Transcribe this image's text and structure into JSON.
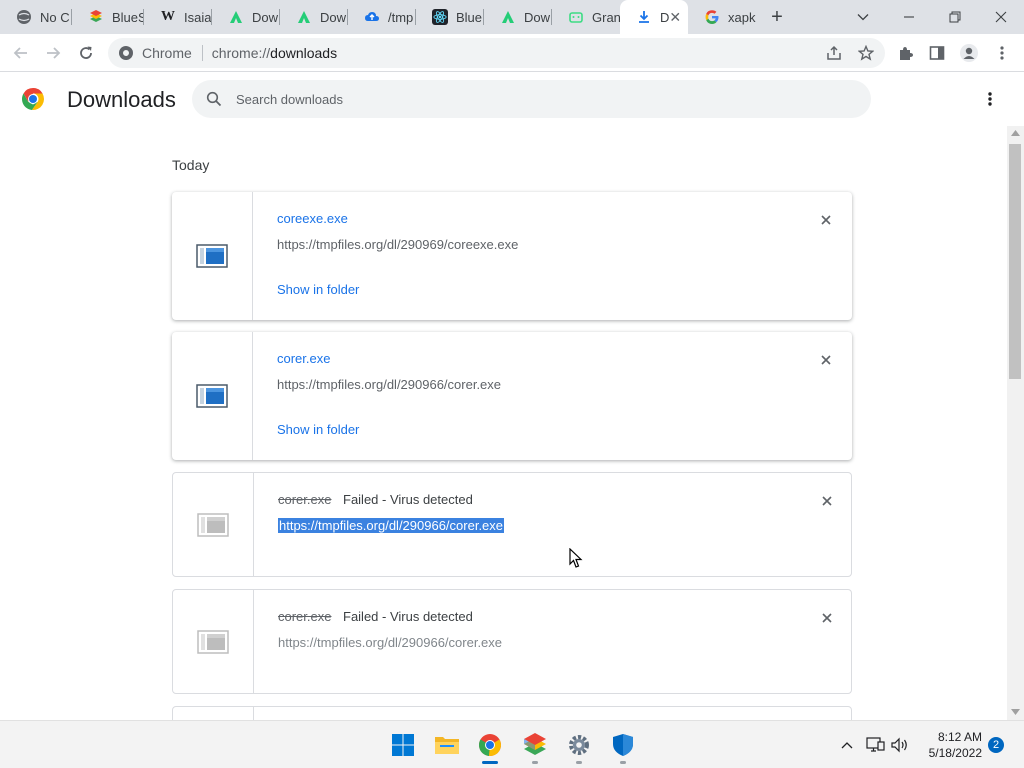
{
  "tabs": [
    {
      "label": "No C",
      "icon": "globe-icon"
    },
    {
      "label": "BlueS",
      "icon": "bluestacks-icon"
    },
    {
      "label": "Isaiah",
      "icon": "wikipedia-icon"
    },
    {
      "label": "Dow",
      "icon": "apkpure-icon"
    },
    {
      "label": "Dow",
      "icon": "apkpure-icon"
    },
    {
      "label": "/tmp",
      "icon": "cloud-upload-icon"
    },
    {
      "label": "Blue",
      "icon": "react-icon"
    },
    {
      "label": "Dow",
      "icon": "apkpure-icon"
    },
    {
      "label": "Gran",
      "icon": "android-icon"
    },
    {
      "label": "D",
      "icon": "download-icon"
    },
    {
      "label": "xapk",
      "icon": "google-icon"
    }
  ],
  "toolbar": {
    "site_label": "Chrome",
    "url_scheme": "chrome://",
    "url_host": "downloads"
  },
  "downloads": {
    "title": "Downloads",
    "search_placeholder": "Search downloads",
    "section_date": "Today",
    "items": [
      {
        "filename": "coreexe.exe",
        "url": "https://tmpfiles.org/dl/290969/coreexe.exe",
        "action": "Show in folder",
        "status": ""
      },
      {
        "filename": "corer.exe",
        "url": "https://tmpfiles.org/dl/290966/corer.exe",
        "action": "Show in folder",
        "status": ""
      },
      {
        "filename": "corer.exe",
        "url": "https://tmpfiles.org/dl/290966/corer.exe",
        "action": "",
        "status": "Failed - Virus detected"
      },
      {
        "filename": "corer.exe",
        "url": "https://tmpfiles.org/dl/290966/corer.exe",
        "action": "",
        "status": "Failed - Virus detected"
      }
    ]
  },
  "taskbar": {
    "time": "8:12 AM",
    "date": "5/18/2022",
    "notification_count": "2"
  },
  "colors": {
    "accent": "#1a73e8",
    "selection": "#3b82e0",
    "windows_blue": "#0067c0"
  }
}
